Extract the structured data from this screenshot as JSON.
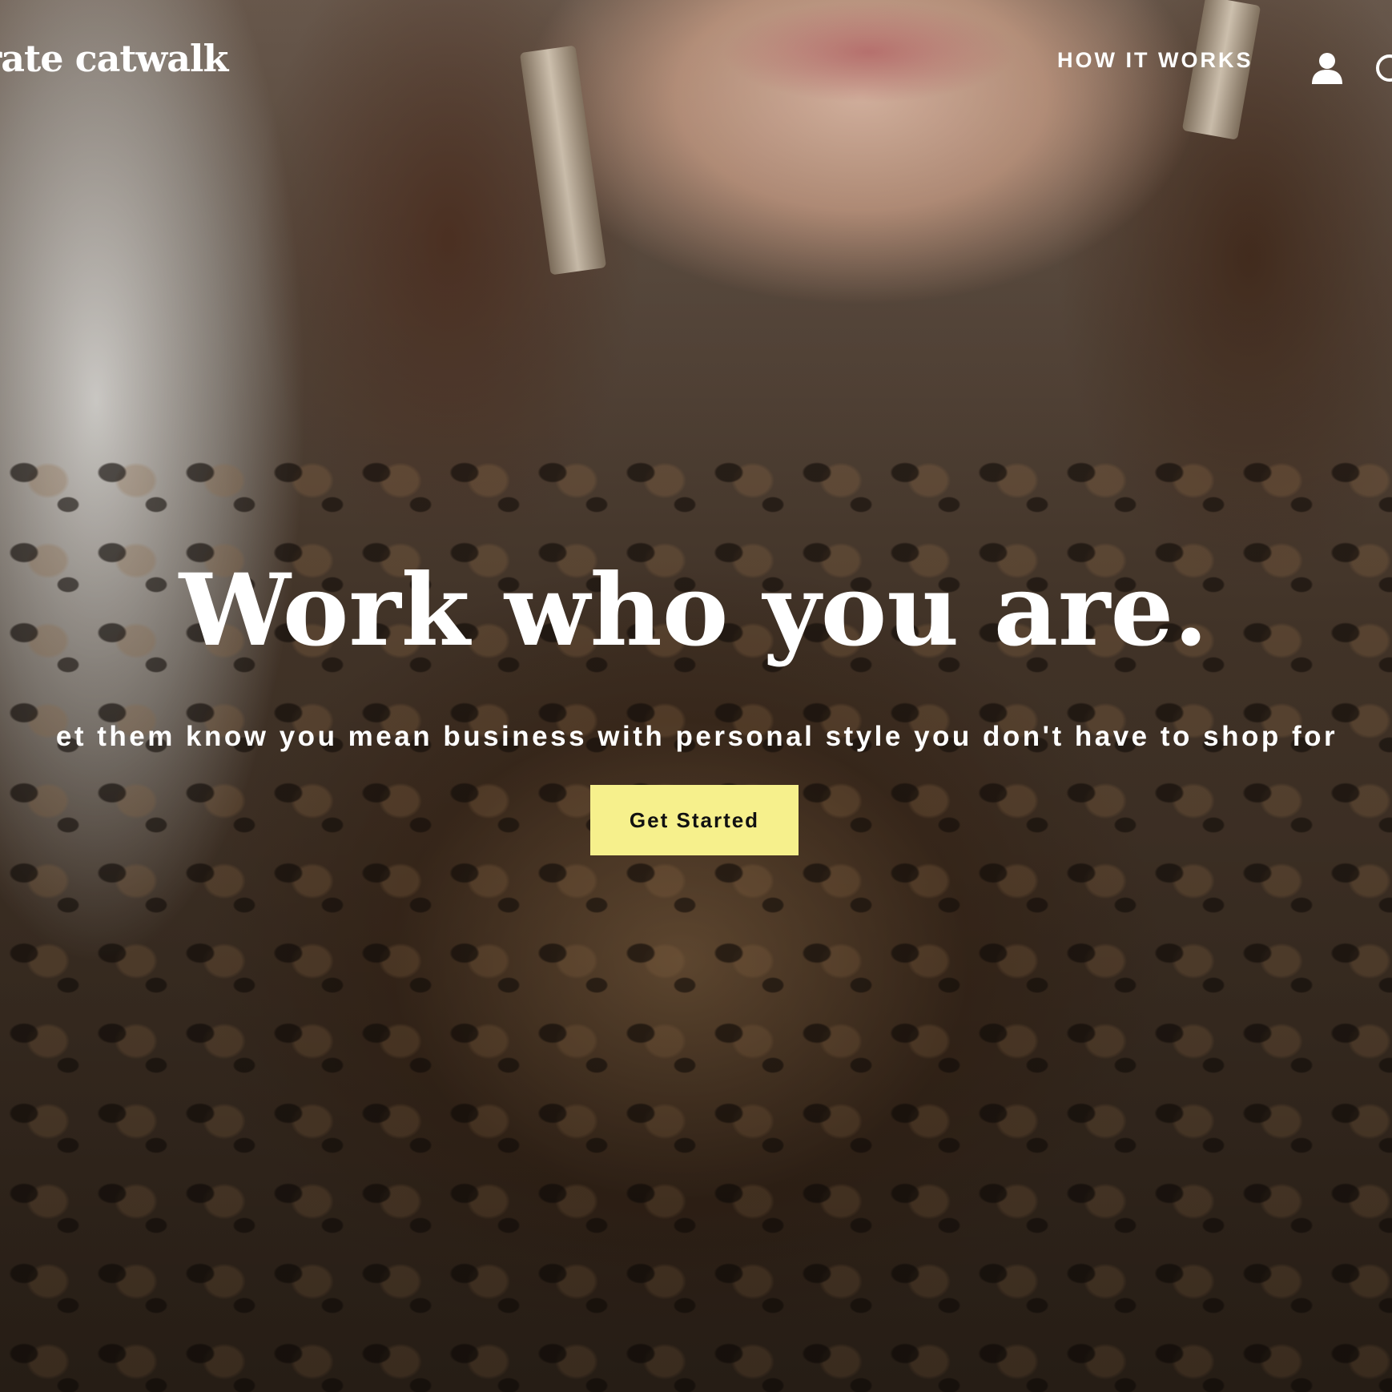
{
  "brand": {
    "logo_text": "rate catwalk"
  },
  "nav": {
    "how_it_works": "HOW IT WORKS",
    "account_icon": "account-icon",
    "cart_icon": "cart-icon"
  },
  "hero": {
    "headline": "Work who you are.",
    "subline": "et them know you mean business with personal style you don't have to shop for",
    "cta_label": "Get Started",
    "cta_color": "#f6f08c",
    "text_color": "#ffffff"
  }
}
